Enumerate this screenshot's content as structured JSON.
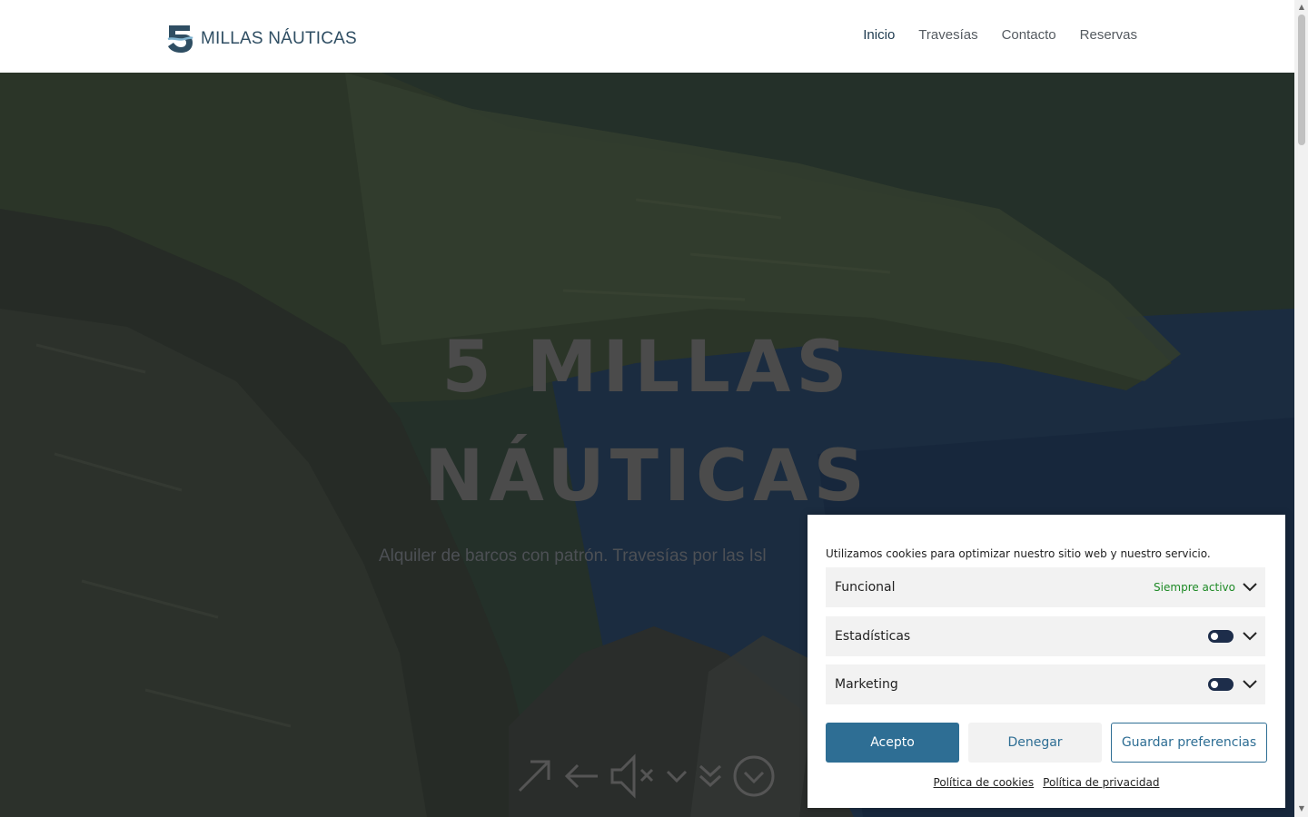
{
  "header": {
    "logo_text": "MILLAS NÁUTICAS",
    "nav": [
      {
        "label": "Inicio",
        "active": true
      },
      {
        "label": "Travesías",
        "active": false
      },
      {
        "label": "Contacto",
        "active": false
      },
      {
        "label": "Reservas",
        "active": false
      }
    ]
  },
  "hero": {
    "title_line1": "5 MILLAS",
    "title_line2": "NÁUTICAS",
    "subtitle": "Alquiler de barcos con patrón. Travesías por las Isl",
    "icons": [
      "arrow-up-right-icon",
      "arrow-left-icon",
      "speaker-muted-icon",
      "chevron-down-icon",
      "double-chevron-down-icon",
      "circle-chevron-down-icon"
    ]
  },
  "cookie": {
    "message": "Utilizamos cookies para optimizar nuestro sitio web y nuestro servicio.",
    "categories": [
      {
        "label": "Funcional",
        "status": "Siempre activo"
      },
      {
        "label": "Estadísticas"
      },
      {
        "label": "Marketing"
      }
    ],
    "buttons": {
      "accept": "Acepto",
      "deny": "Denegar",
      "prefs": "Guardar preferencias"
    },
    "links": {
      "cookies": "Política de cookies",
      "privacy": "Política de privacidad"
    }
  },
  "colors": {
    "accent": "#2e6e94",
    "toggle": "#1d2d4a",
    "always_active": "#1e8a26",
    "logo": "#2f4e63"
  }
}
